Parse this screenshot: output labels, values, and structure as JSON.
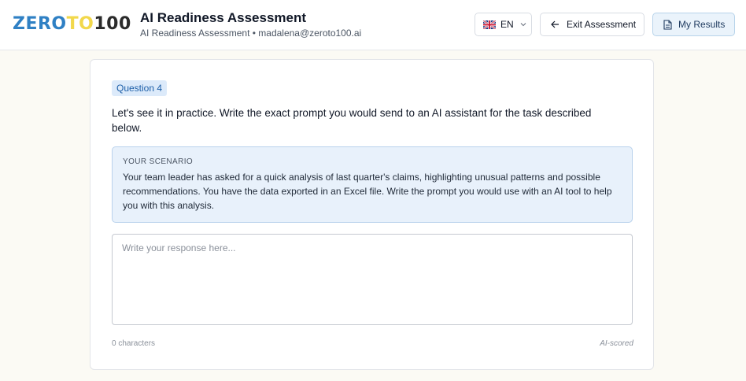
{
  "brand": {
    "logo_part1": "ZERO",
    "logo_part2": "TO",
    "logo_part3": "100",
    "colors": {
      "blue": "#2f80c4",
      "yellow": "#f2d84b",
      "dark": "#2b2b2b"
    }
  },
  "header": {
    "title": "AI Readiness Assessment",
    "subtitle": "AI Readiness Assessment • madalena@zeroto100.ai",
    "language": {
      "flag_icon": "uk-flag-icon",
      "code": "EN"
    },
    "exit_label": "Exit Assessment",
    "results_label": "My Results"
  },
  "question": {
    "badge": "Question 4",
    "prompt": "Let's see it in practice. Write the exact prompt you would send to an AI assistant for the task described below.",
    "scenario_label": "YOUR SCENARIO",
    "scenario_text": "Your team leader has asked for a quick analysis of last quarter's claims, highlighting unusual patterns and possible recommendations. You have the data exported in an Excel file. Write the prompt you would use with an AI tool to help you with this analysis.",
    "response_value": "",
    "response_placeholder": "Write your response here...",
    "char_count": "0 characters",
    "scoring_note": "AI-scored"
  }
}
